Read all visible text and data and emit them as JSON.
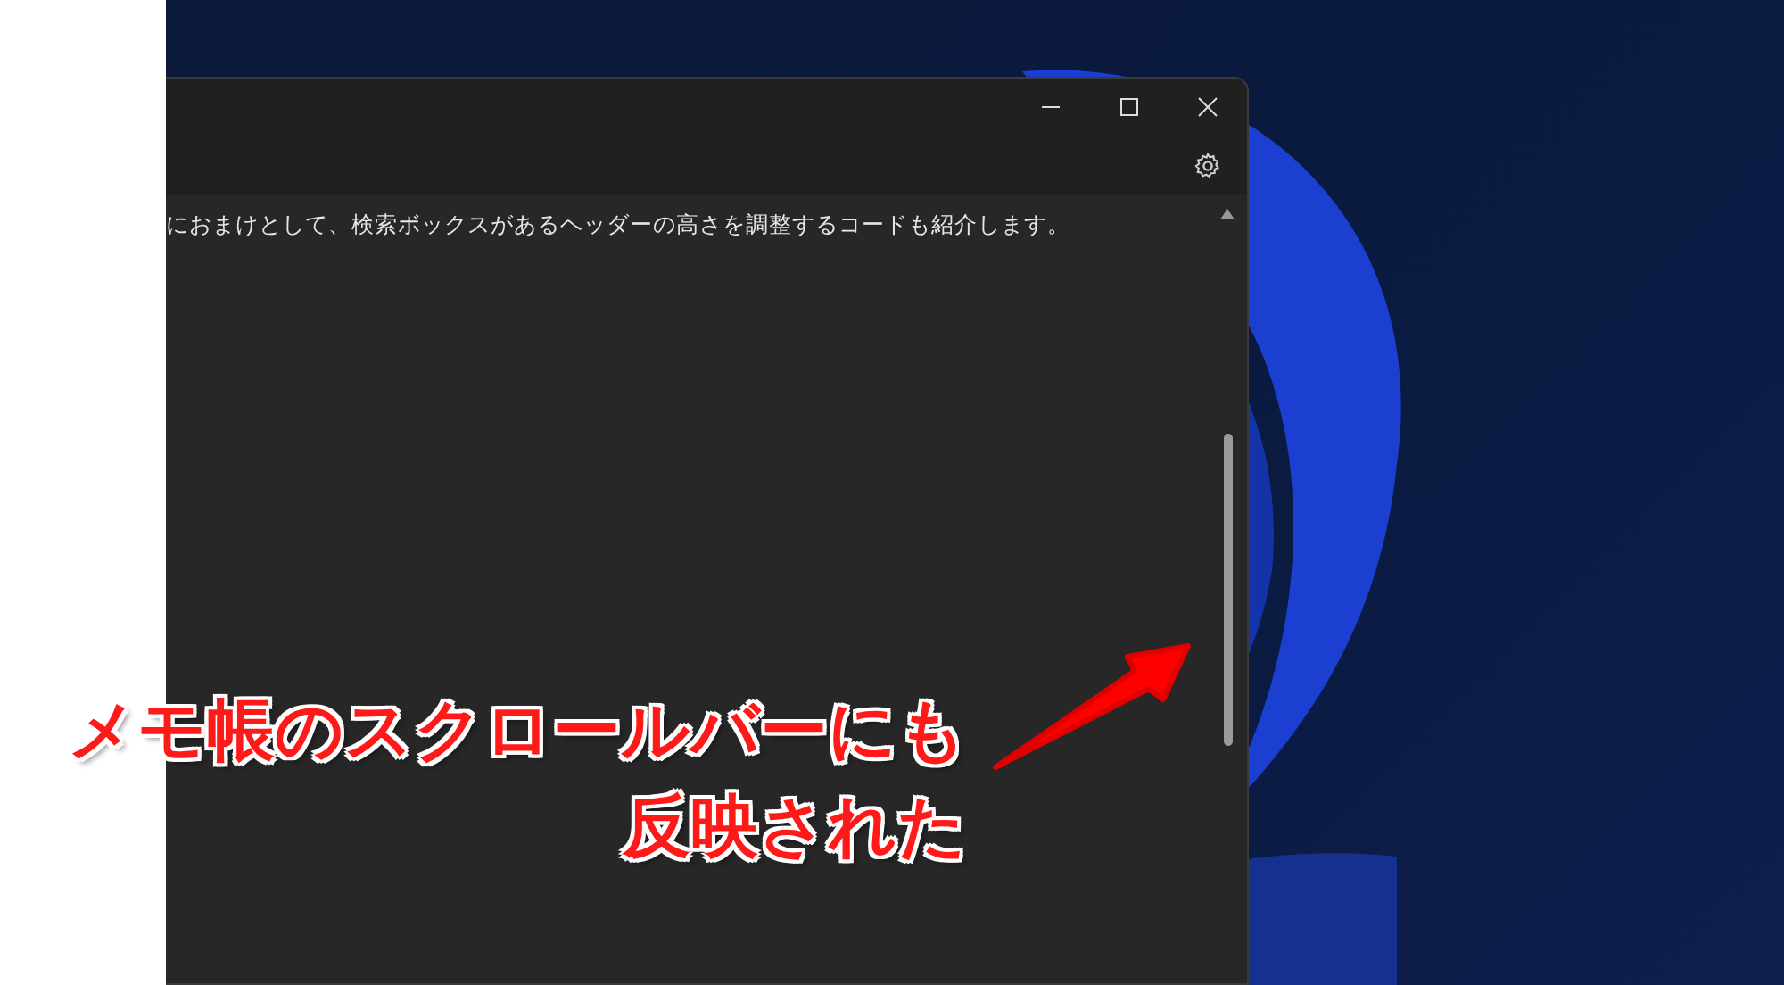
{
  "notepad": {
    "editor_text": "におまけとして、検索ボックスがあるヘッダーの高さを調整するコードも紹介します。"
  },
  "annotation": {
    "lines": [
      "メモ帳のスクロールバーにも",
      "反映された"
    ]
  }
}
